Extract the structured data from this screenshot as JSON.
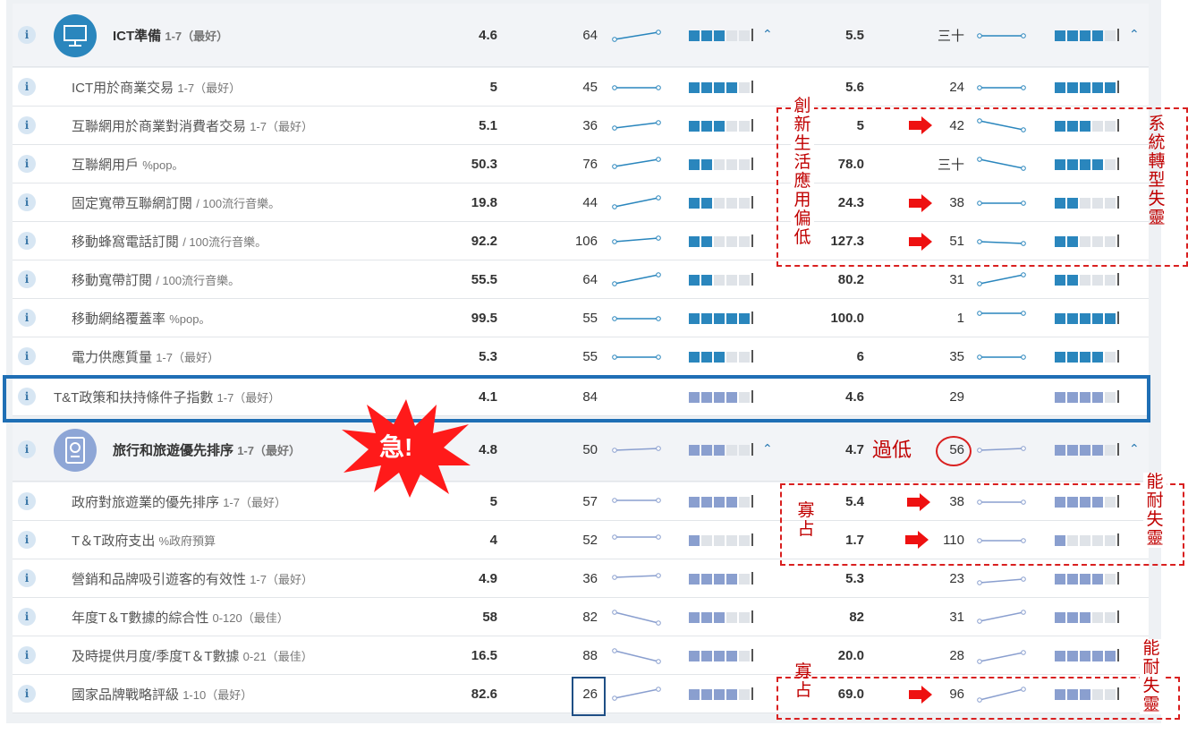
{
  "icons": {
    "info": "i",
    "expand": "^"
  },
  "colors": {
    "ict_accent": "#2a86bd",
    "tt_accent": "#8a9fcf",
    "annotation": "#d92020",
    "highlight_box": "#1f6fb5",
    "badge": "#ff1a1a"
  },
  "sections": [
    {
      "header": {
        "label": "ICT準備",
        "scale": "1-7（最好）",
        "value": "4.6",
        "rank": "64",
        "value2": "5.5",
        "rank2": "三十"
      },
      "rows": [
        {
          "label": "ICT用於商業交易",
          "scale": "1-7（最好）",
          "value": "5",
          "rank": "45",
          "value2": "5.6",
          "rank2": "24"
        },
        {
          "label": "互聯網用於商業對消費者交易",
          "scale": "1-7（最好）",
          "value": "5.1",
          "rank": "36",
          "value2": "5",
          "rank2": "42"
        },
        {
          "label": "互聯網用戶",
          "scale": "%pop。",
          "value": "50.3",
          "rank": "76",
          "value2": "78.0",
          "rank2": "三十"
        },
        {
          "label": "固定寬帶互聯網訂閱",
          "scale": "/ 100流行音樂。",
          "value": "19.8",
          "rank": "44",
          "value2": "24.3",
          "rank2": "38"
        },
        {
          "label": "移動蜂窩電話訂閱",
          "scale": "/ 100流行音樂。",
          "value": "92.2",
          "rank": "106",
          "value2": "127.3",
          "rank2": "51"
        },
        {
          "label": "移動寬帶訂閱",
          "scale": "/ 100流行音樂。",
          "value": "55.5",
          "rank": "64",
          "value2": "80.2",
          "rank2": "31"
        },
        {
          "label": "移動網絡覆蓋率",
          "scale": "%pop。",
          "value": "99.5",
          "rank": "55",
          "value2": "100.0",
          "rank2": "1"
        },
        {
          "label": "電力供應質量",
          "scale": "1-7（最好）",
          "value": "5.3",
          "rank": "55",
          "value2": "6",
          "rank2": "35"
        }
      ]
    },
    {
      "subindex": {
        "label": "T&T政策和扶持條件子指數",
        "scale": "1-7（最好）",
        "value": "4.1",
        "rank": "84",
        "value2": "4.6",
        "rank2": "29"
      }
    },
    {
      "header": {
        "label": "旅行和旅遊優先排序",
        "scale": "1-7（最好）",
        "value": "4.8",
        "rank": "50",
        "value2": "4.7",
        "rank2": "56"
      },
      "rows": [
        {
          "label": "政府對旅遊業的優先排序",
          "scale": "1-7（最好）",
          "value": "5",
          "rank": "57",
          "value2": "5.4",
          "rank2": "38"
        },
        {
          "label": "T＆T政府支出",
          "scale": "%政府預算",
          "value": "4",
          "rank": "52",
          "value2": "1.7",
          "rank2": "110"
        },
        {
          "label": "營銷和品牌吸引遊客的有效性",
          "scale": "1-7（最好）",
          "value": "4.9",
          "rank": "36",
          "value2": "5.3",
          "rank2": "23"
        },
        {
          "label": "年度T＆T數據的綜合性",
          "scale": "0-120（最佳）",
          "value": "58",
          "rank": "82",
          "value2": "82",
          "rank2": "31"
        },
        {
          "label": "及時提供月度/季度T＆T數據",
          "scale": "0-21（最佳）",
          "value": "16.5",
          "rank": "88",
          "value2": "20.0",
          "rank2": "28"
        },
        {
          "label": "國家品牌戰略評級",
          "scale": "1-10（最好）",
          "value": "82.6",
          "rank": "26",
          "value2": "69.0",
          "rank2": "96"
        }
      ]
    }
  ],
  "annotations": {
    "badge": "急!",
    "low_text": "過低",
    "innovation": "創新生活應用偏低",
    "system": "系統轉型失靈",
    "capability1": "能耐失靈",
    "capability2": "能耐失靈",
    "monopoly1": "寡占",
    "monopoly2": "寡占"
  }
}
